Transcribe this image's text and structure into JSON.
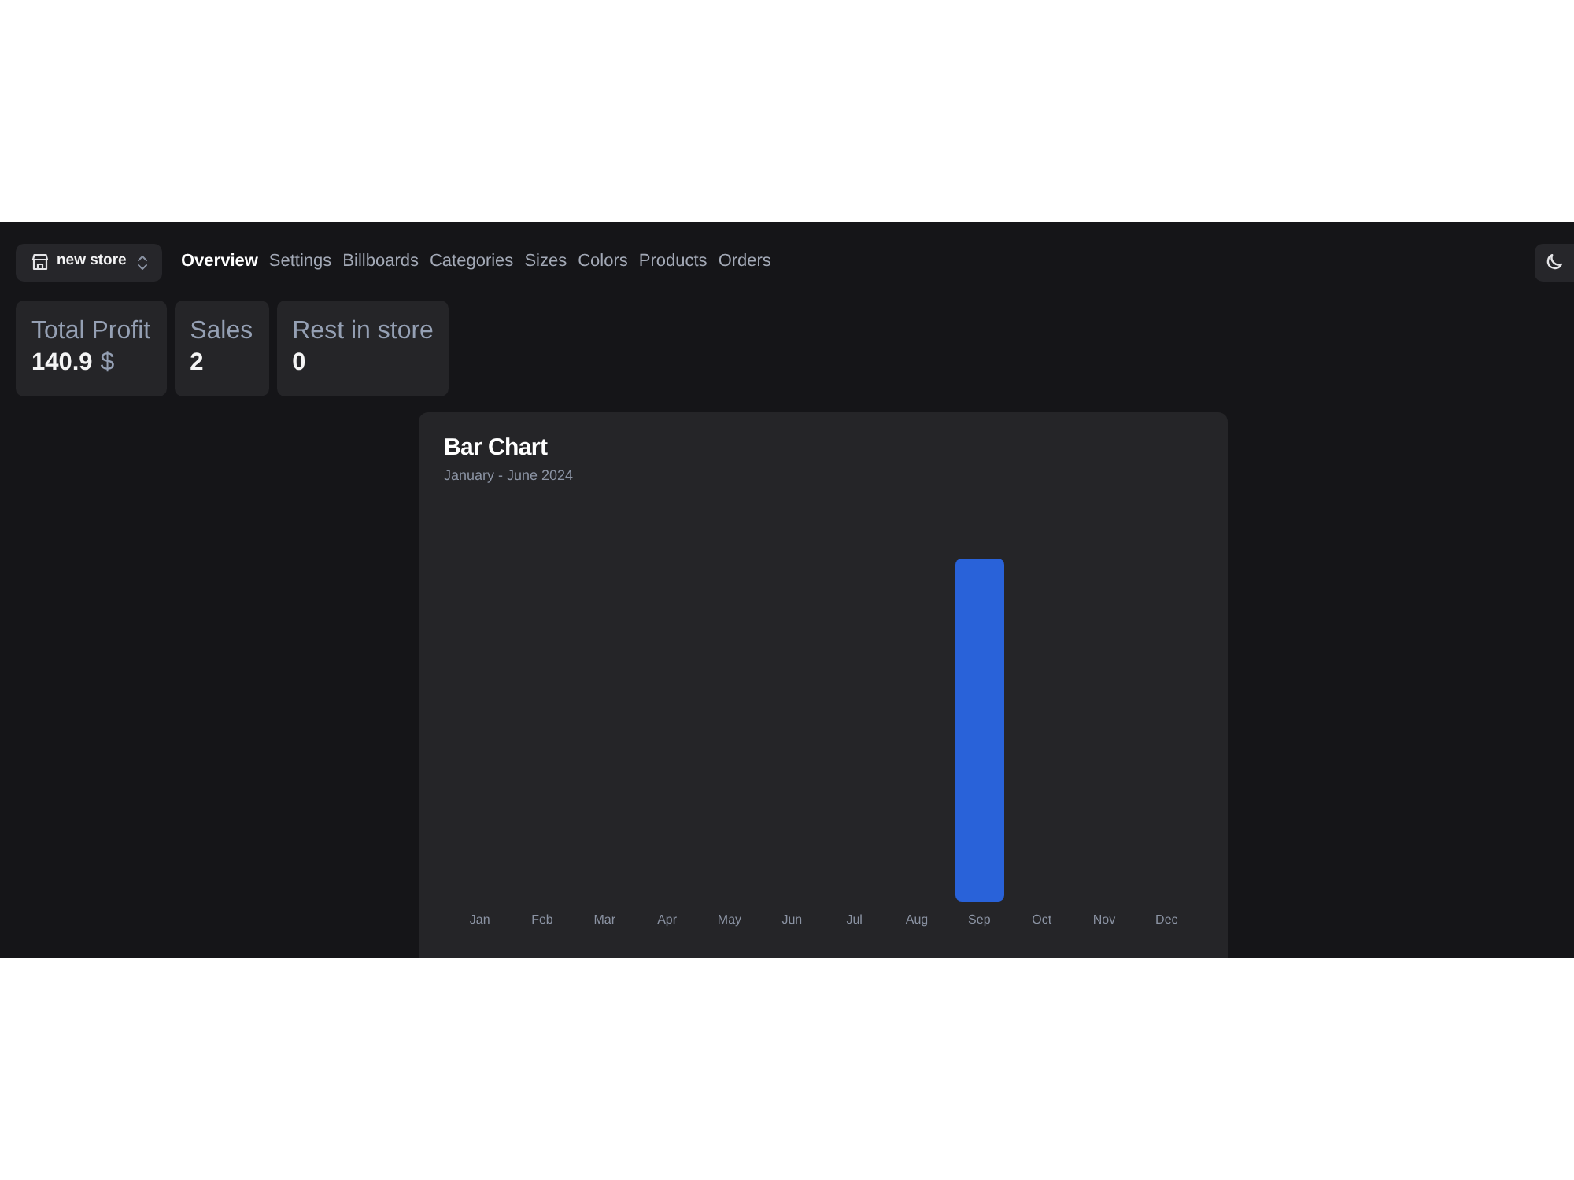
{
  "store_switcher": {
    "label": "new store"
  },
  "nav": [
    {
      "label": "Overview",
      "selected": true
    },
    {
      "label": "Settings",
      "selected": false
    },
    {
      "label": "Billboards",
      "selected": false
    },
    {
      "label": "Categories",
      "selected": false
    },
    {
      "label": "Sizes",
      "selected": false
    },
    {
      "label": "Colors",
      "selected": false
    },
    {
      "label": "Products",
      "selected": false
    },
    {
      "label": "Orders",
      "selected": false
    }
  ],
  "stats": [
    {
      "title": "Total Profit",
      "value": "140.9",
      "unit": "$"
    },
    {
      "title": "Sales",
      "value": "2"
    },
    {
      "title": "Rest in store",
      "value": "0"
    }
  ],
  "chart": {
    "title": "Bar Chart",
    "subtitle": "January - June 2024",
    "x_labels": [
      "Jan",
      "Feb",
      "Mar",
      "Apr",
      "May",
      "Jun",
      "Jul",
      "Aug",
      "Sep",
      "Oct",
      "Nov",
      "Dec"
    ]
  }
}
